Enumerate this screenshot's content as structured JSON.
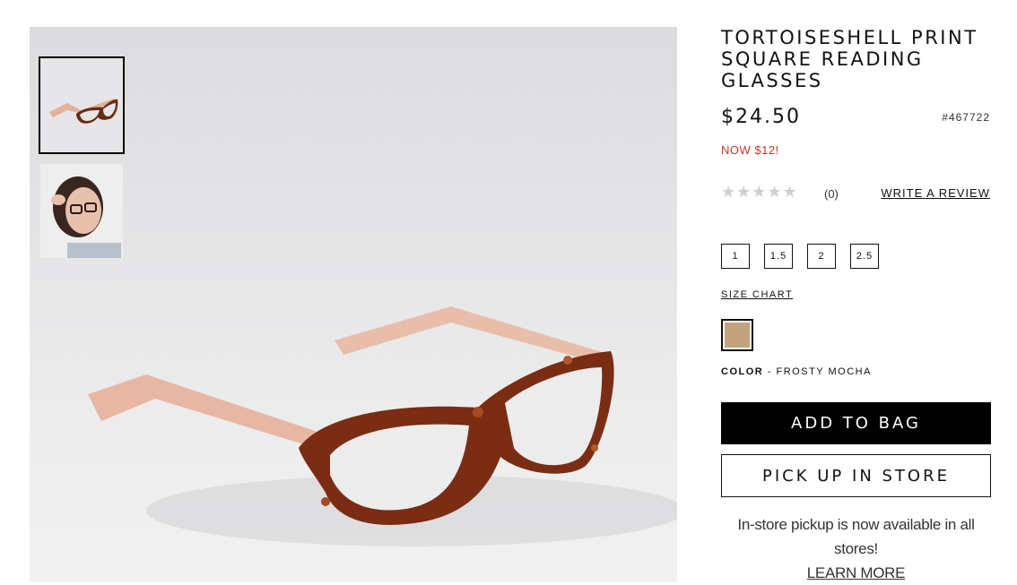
{
  "product": {
    "title": "TORTOISESHELL PRINT SQUARE READING GLASSES",
    "price": "$24.50",
    "sku": "#467722",
    "sale_text": "NOW $12!"
  },
  "rating": {
    "stars_display": "★★★★★",
    "value": 0,
    "max": 5,
    "count": "(0)",
    "write_review": "WRITE A REVIEW"
  },
  "sizes": [
    "1",
    "1.5",
    "2",
    "2.5"
  ],
  "size_chart": "SIZE CHART",
  "color": {
    "label": "COLOR",
    "separator": " - ",
    "name": "FROSTY MOCHA",
    "swatch_hex": "#c3a37d"
  },
  "buttons": {
    "add_to_bag": "ADD TO BAG",
    "pick_up": "PICK UP IN STORE"
  },
  "pickup": {
    "note": "In-store pickup is now available in all stores!",
    "learn_more": "LEARN MORE"
  },
  "thumbnails": [
    {
      "icon": "glasses-thumbnail",
      "selected": true
    },
    {
      "icon": "model-wearing-glasses-thumbnail",
      "selected": false
    }
  ],
  "colors": {
    "accent_sale": "#c0392b",
    "primary_button": "#000000"
  }
}
